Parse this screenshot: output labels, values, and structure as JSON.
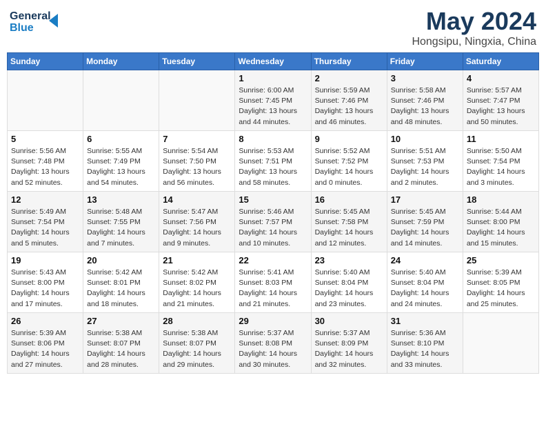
{
  "logo": {
    "line1": "General",
    "line2": "Blue"
  },
  "title": "May 2024",
  "subtitle": "Hongsipu, Ningxia, China",
  "days_of_week": [
    "Sunday",
    "Monday",
    "Tuesday",
    "Wednesday",
    "Thursday",
    "Friday",
    "Saturday"
  ],
  "weeks": [
    [
      {
        "day": "",
        "info": ""
      },
      {
        "day": "",
        "info": ""
      },
      {
        "day": "",
        "info": ""
      },
      {
        "day": "1",
        "info": "Sunrise: 6:00 AM\nSunset: 7:45 PM\nDaylight: 13 hours\nand 44 minutes."
      },
      {
        "day": "2",
        "info": "Sunrise: 5:59 AM\nSunset: 7:46 PM\nDaylight: 13 hours\nand 46 minutes."
      },
      {
        "day": "3",
        "info": "Sunrise: 5:58 AM\nSunset: 7:46 PM\nDaylight: 13 hours\nand 48 minutes."
      },
      {
        "day": "4",
        "info": "Sunrise: 5:57 AM\nSunset: 7:47 PM\nDaylight: 13 hours\nand 50 minutes."
      }
    ],
    [
      {
        "day": "5",
        "info": "Sunrise: 5:56 AM\nSunset: 7:48 PM\nDaylight: 13 hours\nand 52 minutes."
      },
      {
        "day": "6",
        "info": "Sunrise: 5:55 AM\nSunset: 7:49 PM\nDaylight: 13 hours\nand 54 minutes."
      },
      {
        "day": "7",
        "info": "Sunrise: 5:54 AM\nSunset: 7:50 PM\nDaylight: 13 hours\nand 56 minutes."
      },
      {
        "day": "8",
        "info": "Sunrise: 5:53 AM\nSunset: 7:51 PM\nDaylight: 13 hours\nand 58 minutes."
      },
      {
        "day": "9",
        "info": "Sunrise: 5:52 AM\nSunset: 7:52 PM\nDaylight: 14 hours\nand 0 minutes."
      },
      {
        "day": "10",
        "info": "Sunrise: 5:51 AM\nSunset: 7:53 PM\nDaylight: 14 hours\nand 2 minutes."
      },
      {
        "day": "11",
        "info": "Sunrise: 5:50 AM\nSunset: 7:54 PM\nDaylight: 14 hours\nand 3 minutes."
      }
    ],
    [
      {
        "day": "12",
        "info": "Sunrise: 5:49 AM\nSunset: 7:54 PM\nDaylight: 14 hours\nand 5 minutes."
      },
      {
        "day": "13",
        "info": "Sunrise: 5:48 AM\nSunset: 7:55 PM\nDaylight: 14 hours\nand 7 minutes."
      },
      {
        "day": "14",
        "info": "Sunrise: 5:47 AM\nSunset: 7:56 PM\nDaylight: 14 hours\nand 9 minutes."
      },
      {
        "day": "15",
        "info": "Sunrise: 5:46 AM\nSunset: 7:57 PM\nDaylight: 14 hours\nand 10 minutes."
      },
      {
        "day": "16",
        "info": "Sunrise: 5:45 AM\nSunset: 7:58 PM\nDaylight: 14 hours\nand 12 minutes."
      },
      {
        "day": "17",
        "info": "Sunrise: 5:45 AM\nSunset: 7:59 PM\nDaylight: 14 hours\nand 14 minutes."
      },
      {
        "day": "18",
        "info": "Sunrise: 5:44 AM\nSunset: 8:00 PM\nDaylight: 14 hours\nand 15 minutes."
      }
    ],
    [
      {
        "day": "19",
        "info": "Sunrise: 5:43 AM\nSunset: 8:00 PM\nDaylight: 14 hours\nand 17 minutes."
      },
      {
        "day": "20",
        "info": "Sunrise: 5:42 AM\nSunset: 8:01 PM\nDaylight: 14 hours\nand 18 minutes."
      },
      {
        "day": "21",
        "info": "Sunrise: 5:42 AM\nSunset: 8:02 PM\nDaylight: 14 hours\nand 21 minutes."
      },
      {
        "day": "22",
        "info": "Sunrise: 5:41 AM\nSunset: 8:03 PM\nDaylight: 14 hours\nand 21 minutes."
      },
      {
        "day": "23",
        "info": "Sunrise: 5:40 AM\nSunset: 8:04 PM\nDaylight: 14 hours\nand 23 minutes."
      },
      {
        "day": "24",
        "info": "Sunrise: 5:40 AM\nSunset: 8:04 PM\nDaylight: 14 hours\nand 24 minutes."
      },
      {
        "day": "25",
        "info": "Sunrise: 5:39 AM\nSunset: 8:05 PM\nDaylight: 14 hours\nand 25 minutes."
      }
    ],
    [
      {
        "day": "26",
        "info": "Sunrise: 5:39 AM\nSunset: 8:06 PM\nDaylight: 14 hours\nand 27 minutes."
      },
      {
        "day": "27",
        "info": "Sunrise: 5:38 AM\nSunset: 8:07 PM\nDaylight: 14 hours\nand 28 minutes."
      },
      {
        "day": "28",
        "info": "Sunrise: 5:38 AM\nSunset: 8:07 PM\nDaylight: 14 hours\nand 29 minutes."
      },
      {
        "day": "29",
        "info": "Sunrise: 5:37 AM\nSunset: 8:08 PM\nDaylight: 14 hours\nand 30 minutes."
      },
      {
        "day": "30",
        "info": "Sunrise: 5:37 AM\nSunset: 8:09 PM\nDaylight: 14 hours\nand 32 minutes."
      },
      {
        "day": "31",
        "info": "Sunrise: 5:36 AM\nSunset: 8:10 PM\nDaylight: 14 hours\nand 33 minutes."
      },
      {
        "day": "",
        "info": ""
      }
    ]
  ]
}
